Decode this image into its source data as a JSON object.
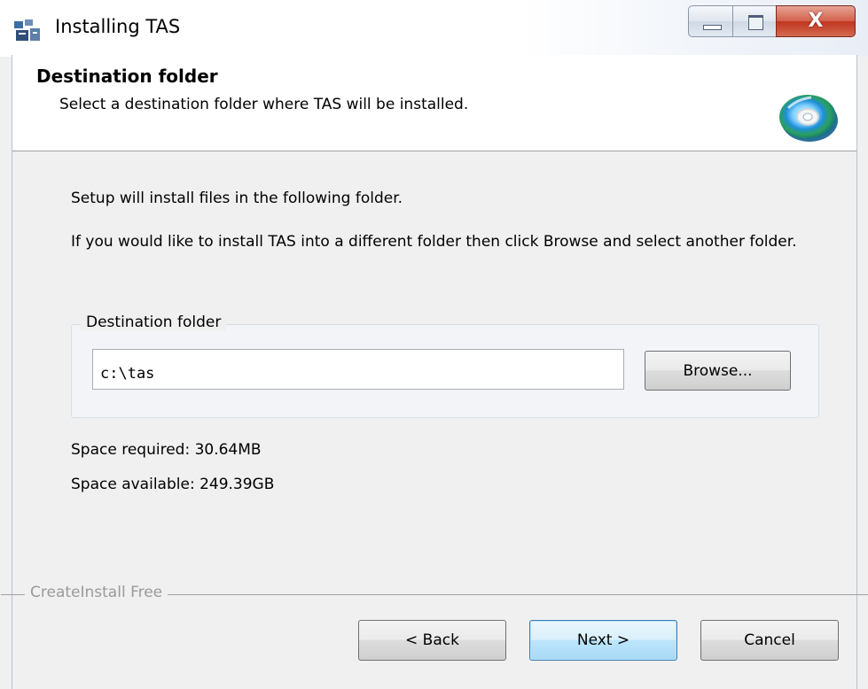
{
  "window": {
    "title": "Installing TAS",
    "close_glyph": "X"
  },
  "header": {
    "title": "Destination folder",
    "subtitle": "Select a destination folder where TAS will be installed."
  },
  "body": {
    "line1": "Setup will install files in the following folder.",
    "line2": "If you would like to install TAS into a different folder then click Browse and select another folder."
  },
  "destination_group": {
    "legend": "Destination folder",
    "path_value": "c:\\tas",
    "browse_label": "Browse..."
  },
  "space": {
    "required": "Space required: 30.64MB",
    "available": "Space available: 249.39GB"
  },
  "brand": "CreateInstall Free",
  "buttons": {
    "back": "< Back",
    "next": "Next >",
    "cancel": "Cancel"
  },
  "icons": {
    "app": "installer-icon",
    "header": "cd-disc-icon"
  },
  "colors": {
    "close_button": "#c84a32",
    "default_button_border": "#3c7fb1"
  }
}
